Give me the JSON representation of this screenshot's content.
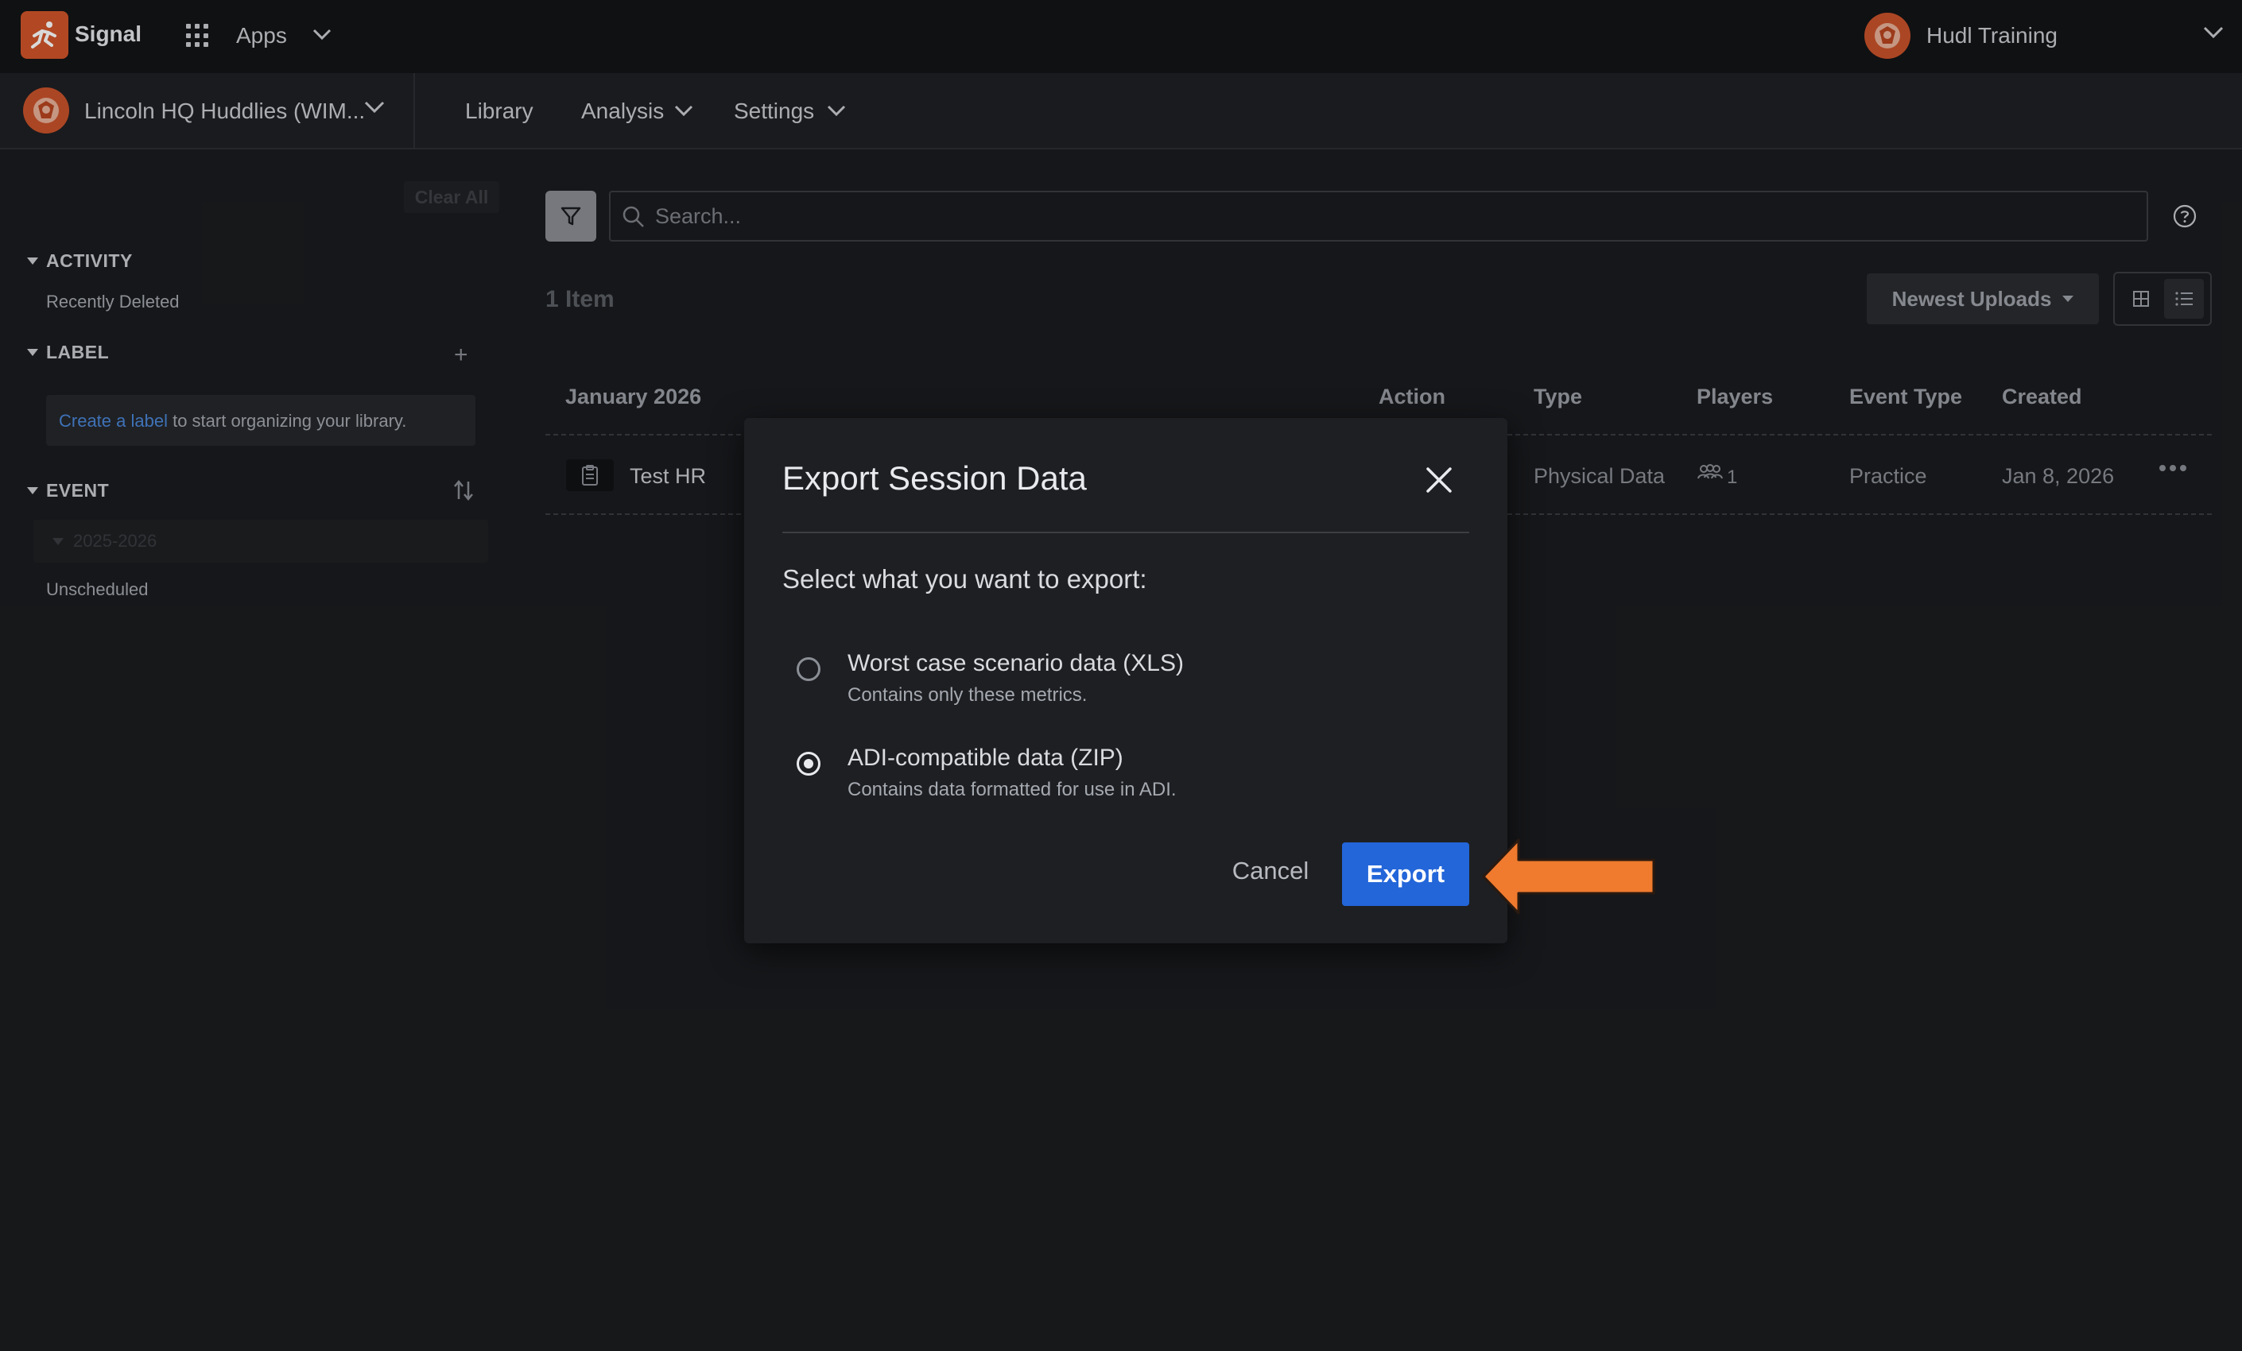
{
  "topbar": {
    "brand": "Signal",
    "apps_label": "Apps",
    "user_name": "Hudl Training"
  },
  "navbar": {
    "team_name": "Lincoln HQ Huddlies (WIM...",
    "items": [
      {
        "label": "Library"
      },
      {
        "label": "Analysis"
      },
      {
        "label": "Settings"
      }
    ]
  },
  "sidebar": {
    "clear_all": "Clear All",
    "activity": {
      "heading": "ACTIVITY",
      "item": "Recently Deleted"
    },
    "label": {
      "heading": "LABEL",
      "link_text": "Create a label",
      "rest_text": " to start organizing your library."
    },
    "event": {
      "heading": "EVENT",
      "season": "2025-2026",
      "item": "Unscheduled"
    }
  },
  "main": {
    "search_placeholder": "Search...",
    "item_count": "1 Item",
    "sort_label": "Newest Uploads",
    "table": {
      "group_header": "January 2026",
      "columns": [
        "Action",
        "Type",
        "Players",
        "Event Type",
        "Created"
      ],
      "rows": [
        {
          "name": "Test HR",
          "type": "Physical Data",
          "players": "1",
          "event_type": "Practice",
          "created": "Jan 8, 2026"
        }
      ]
    }
  },
  "modal": {
    "title": "Export Session Data",
    "prompt": "Select what you want to export:",
    "options": [
      {
        "title": "Worst case scenario data (XLS)",
        "description": "Contains only these metrics.",
        "selected": false
      },
      {
        "title": "ADI-compatible data (ZIP)",
        "description": "Contains data formatted for use in ADI.",
        "selected": true
      }
    ],
    "cancel_label": "Cancel",
    "export_label": "Export"
  },
  "colors": {
    "accent": "#2366d9",
    "brand": "#d2552a",
    "annotation_arrow": "#f07a2e"
  }
}
